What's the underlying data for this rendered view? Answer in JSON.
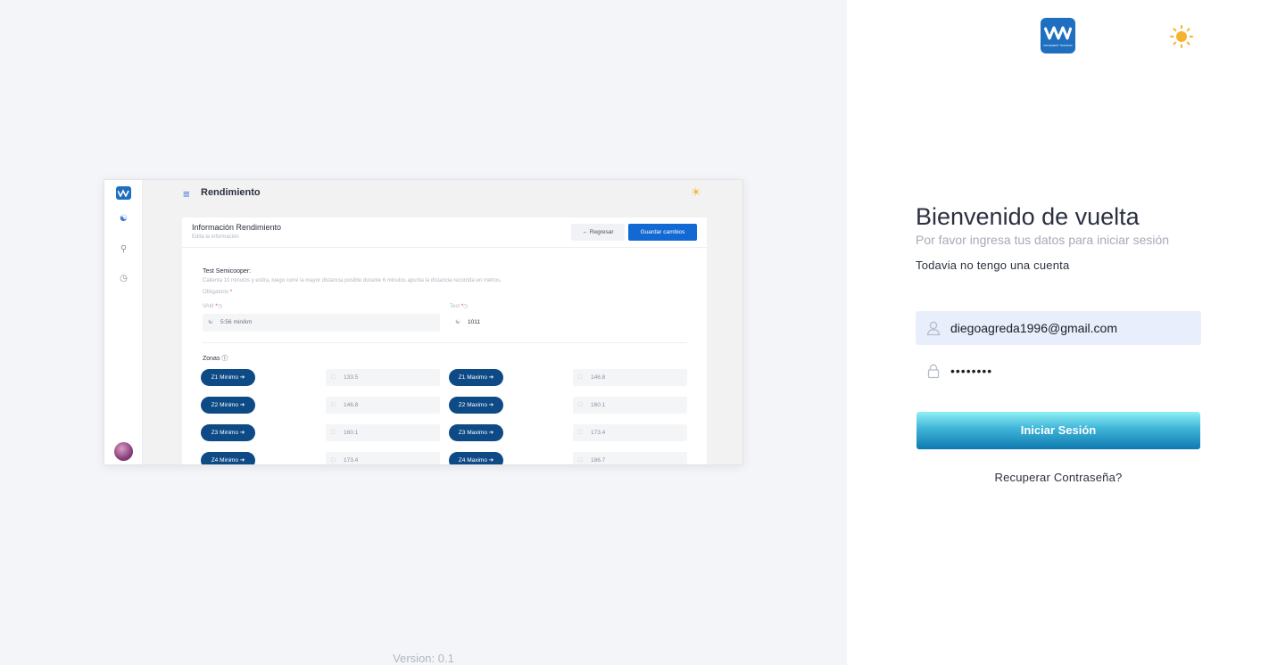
{
  "app": {
    "brand_text": "MOVEMENT TRAINING"
  },
  "preview": {
    "header_title": "Rendimiento",
    "card_title": "Información Rendimiento",
    "card_subtitle": "Edita la información",
    "back_label": "← Regresar",
    "save_label": "Guardar cambios",
    "test_name": "Test Semicooper:",
    "test_desc": "Calienta 10 minutos y estira, luego corre la mayor distancia posible durante 6 minutos apunta la distancia recorrida en metros.",
    "required_label": "Obligatorio",
    "vam_label": "VAM",
    "vam_value": "5:56 min/km",
    "test_label": "Test",
    "test_value": "1011",
    "zonas_label": "Zonas",
    "zones": [
      {
        "min_label": "Z1 Minimo ➔",
        "min_value": "133.5",
        "max_label": "Z1 Maximo ➔",
        "max_value": "146.8"
      },
      {
        "min_label": "Z2 Minimo ➔",
        "min_value": "146.8",
        "max_label": "Z2 Maximo ➔",
        "max_value": "160.1"
      },
      {
        "min_label": "Z3 Minimo ➔",
        "min_value": "160.1",
        "max_label": "Z3 Maximo ➔",
        "max_value": "173.4"
      },
      {
        "min_label": "Z4 Minimo ➔",
        "min_value": "173.4",
        "max_label": "Z4 Maximo ➔",
        "max_value": "186.7"
      }
    ]
  },
  "version": "Version: 0.1",
  "login": {
    "title": "Bienvenido de vuelta",
    "subtitle": "Por favor ingresa tus datos para iniciar sesión",
    "signup_link": "Todavia no tengo una cuenta",
    "email_value": "diegoagreda1996@gmail.com",
    "password_value": "••••••••",
    "submit_label": "Iniciar Sesión",
    "recover_link": "Recuperar Contraseña?"
  },
  "colors": {
    "brand": "#1f6fc0",
    "accent_sun": "#f4b22e",
    "zone_button": "#0d4a86",
    "save_button": "#1269d3"
  }
}
